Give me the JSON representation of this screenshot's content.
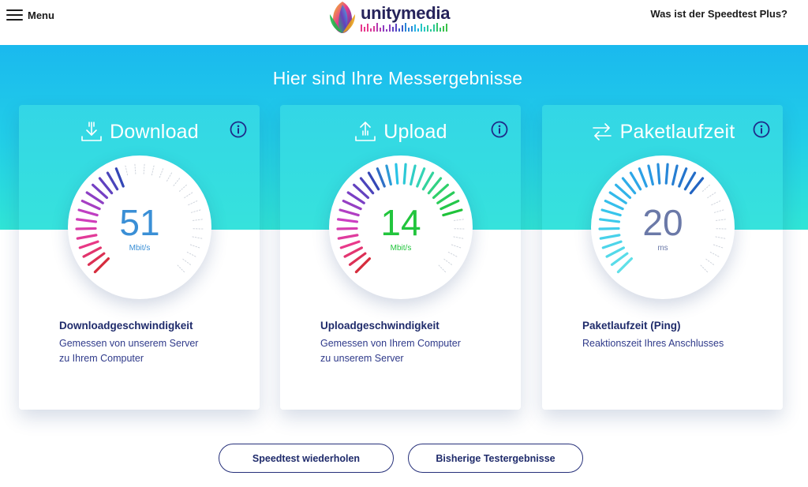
{
  "header": {
    "menu_label": "Menu",
    "logo_text": "unitymedia",
    "help_link": "Was ist der Speedtest Plus?"
  },
  "hero": {
    "title": "Hier sind Ihre Messergebnisse"
  },
  "cards": [
    {
      "title": "Download",
      "icon": "download-icon",
      "value": "51",
      "unit": "Mbit/s",
      "value_color": "#3a8fd6",
      "desc_title": "Downloadgeschwindigkeit",
      "desc_lines": [
        "Gemessen von unserem Server",
        "zu Ihrem Computer"
      ],
      "active_ticks": 14,
      "palette": [
        "#d62c3c",
        "#e9398b",
        "#cc3fc2",
        "#7a3fc4",
        "#3447b6"
      ]
    },
    {
      "title": "Upload",
      "icon": "upload-icon",
      "value": "14",
      "unit": "Mbit/s",
      "value_color": "#22c53d",
      "desc_title": "Uploadgeschwindigkeit",
      "desc_lines": [
        "Gemessen von Ihrem Computer",
        "zu unserem Server"
      ],
      "active_ticks": 25,
      "palette": [
        "#d62c3c",
        "#e9398b",
        "#cc3fc2",
        "#7a3fc4",
        "#3447b6",
        "#29c3e6",
        "#34d4b6",
        "#2fd06a",
        "#1fc33a"
      ]
    },
    {
      "title": "Paketlaufzeit",
      "icon": "ping-arrows-icon",
      "value": "20",
      "unit": "ms",
      "value_color": "#6b79a8",
      "desc_title": "Paketlaufzeit (Ping)",
      "desc_lines": [
        "Reaktionszeit Ihres Anschlusses"
      ],
      "active_ticks": 21,
      "palette": [
        "#5fe0e8",
        "#38c7ec",
        "#2a9ee6",
        "#2264c2"
      ]
    }
  ],
  "buttons": {
    "repeat": "Speedtest wiederholen",
    "history": "Bisherige Testergebnisse"
  },
  "colors": {
    "accent_dark": "#1f2b6b",
    "hero_top": "#1ab9ee",
    "hero_bottom": "#30e5d6"
  }
}
